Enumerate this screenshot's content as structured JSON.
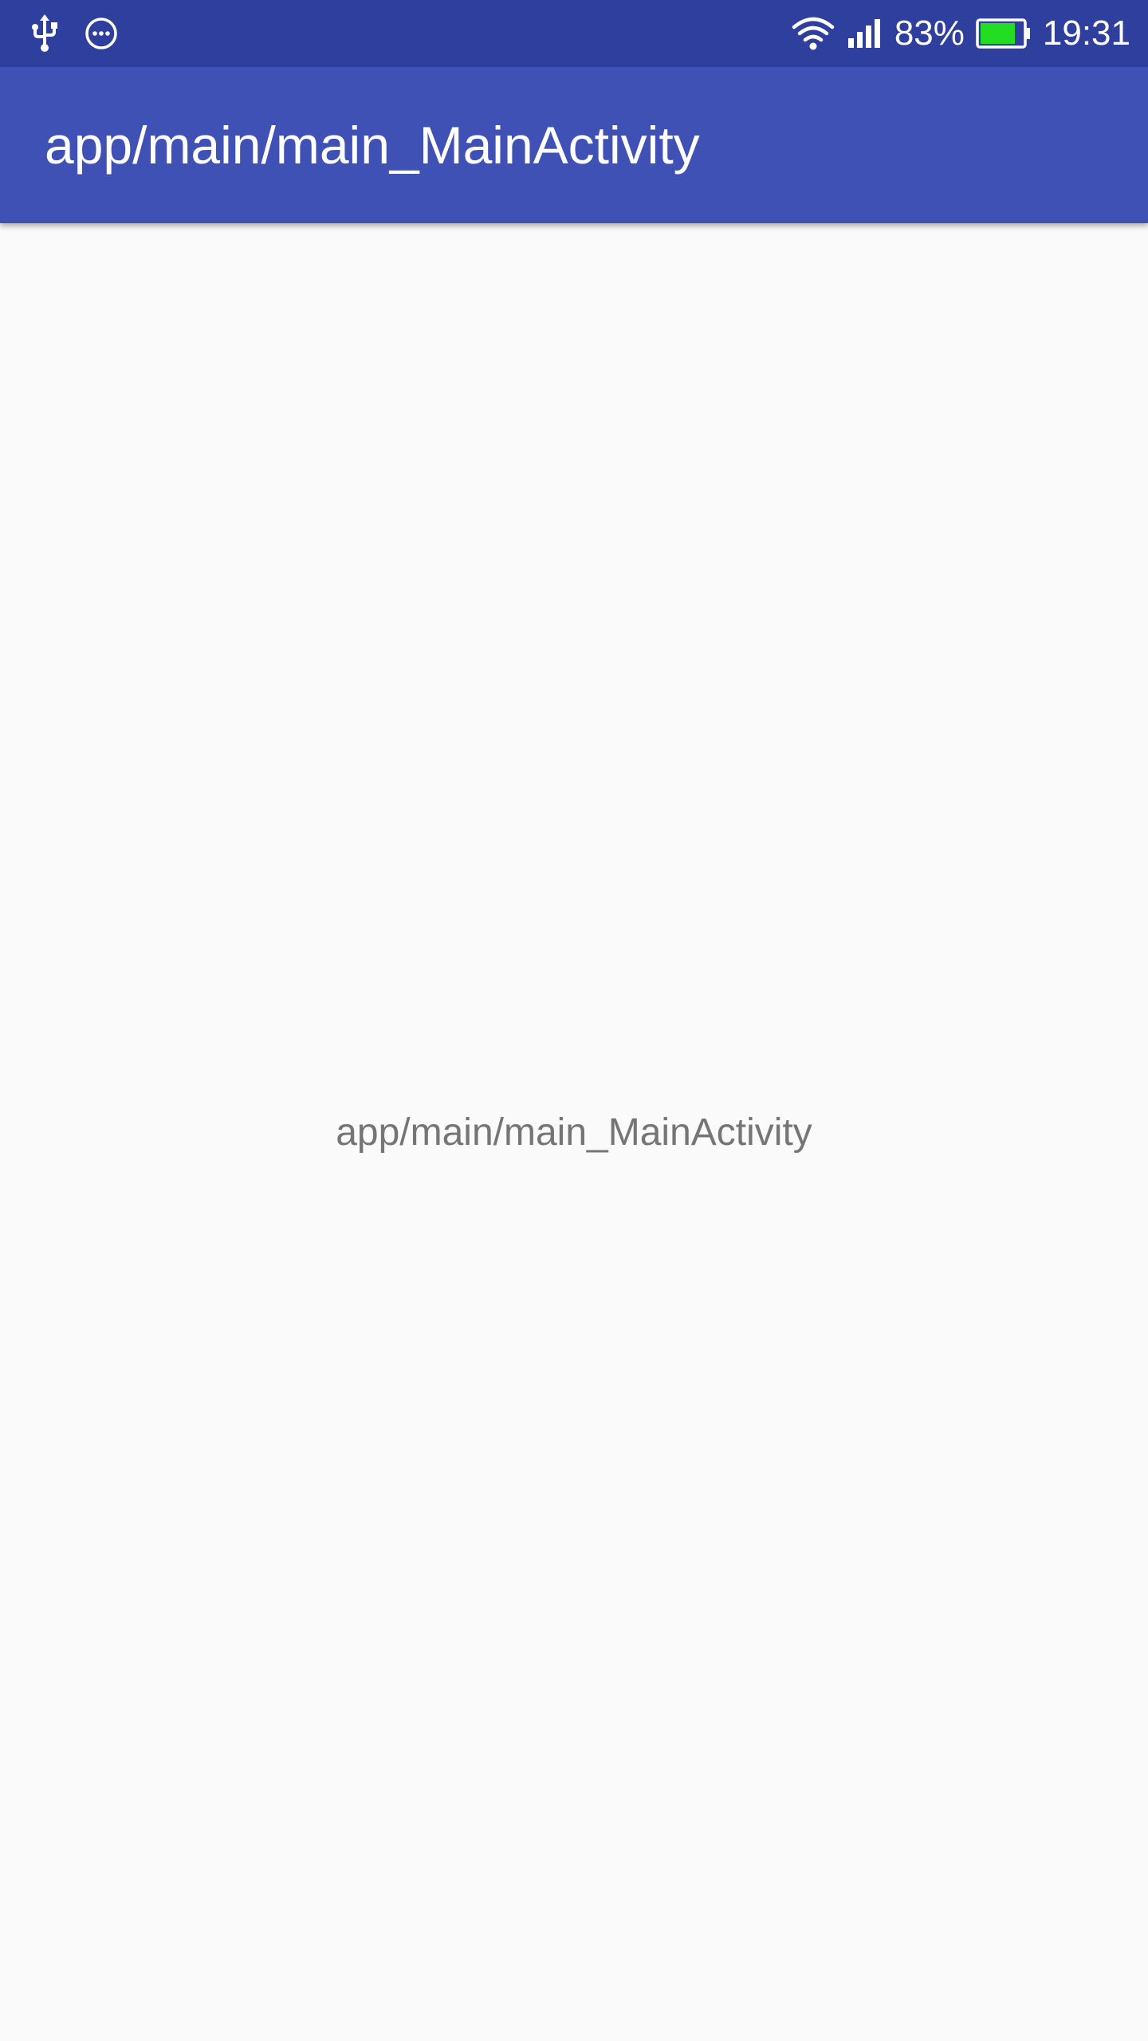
{
  "status_bar": {
    "left_icons": [
      "usb-icon",
      "more-notifications-icon"
    ],
    "right_icons": [
      "wifi-icon",
      "signal-icon",
      "battery-icon"
    ],
    "battery_percent": "83%",
    "battery_level": 0.83,
    "time": "19:31",
    "background_color": "#2f3f9e"
  },
  "app_bar": {
    "title": "app/main/main_MainActivity",
    "background_color": "#3f51b5"
  },
  "main": {
    "label": "app/main/main_MainActivity",
    "text_color": "#757575"
  }
}
